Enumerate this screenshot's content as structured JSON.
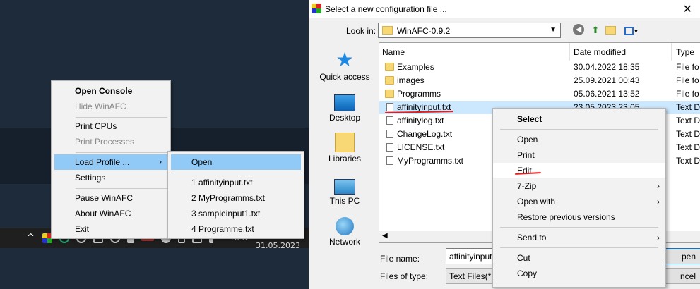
{
  "tray_menu": {
    "items": [
      {
        "label": "Open Console",
        "state": "bold"
      },
      {
        "label": "Hide WinAFC",
        "state": "disabled"
      },
      {
        "label": "Print CPUs",
        "state": "normal"
      },
      {
        "label": "Print Processes",
        "state": "disabled"
      },
      {
        "label": "Load Profile ...",
        "state": "highlighted"
      },
      {
        "label": "Settings",
        "state": "normal"
      },
      {
        "label": "Pause WinAFC",
        "state": "normal"
      },
      {
        "label": "About WinAFC",
        "state": "normal"
      },
      {
        "label": "Exit",
        "state": "normal"
      }
    ],
    "submenu_arrow": "›"
  },
  "profile_submenu": {
    "items": [
      "Open",
      "1 affinityinput.txt",
      "2 MyProgramms.txt",
      "3 sampleinput1.txt",
      "4 Programme.txt"
    ]
  },
  "taskbar": {
    "language": "DEU",
    "date": "31.05.2023",
    "chevron": "^"
  },
  "dialog": {
    "title": "Select a new configuration file ...",
    "close_glyph": "✕",
    "look_in_label": "Look in:",
    "look_in_value": "WinAFC-0.9.2",
    "places": [
      {
        "label": "Quick access",
        "icon": "star-icon"
      },
      {
        "label": "Desktop",
        "icon": "desktop-icon"
      },
      {
        "label": "Libraries",
        "icon": "libraries-icon"
      },
      {
        "label": "This PC",
        "icon": "computer-icon"
      },
      {
        "label": "Network",
        "icon": "network-icon"
      }
    ],
    "columns": {
      "name": "Name",
      "date": "Date modified",
      "type": "Type"
    },
    "files": [
      {
        "name": "Examples",
        "date": "30.04.2022 18:35",
        "type": "File fo",
        "kind": "folder"
      },
      {
        "name": "images",
        "date": "25.09.2021 00:43",
        "type": "File fo",
        "kind": "folder"
      },
      {
        "name": "Programms",
        "date": "05.06.2021 13:52",
        "type": "File fo",
        "kind": "folder"
      },
      {
        "name": "affinityinput.txt",
        "date": "23.05.2023 23:05",
        "type": "Text D",
        "kind": "file",
        "selected": true
      },
      {
        "name": "affinitylog.txt",
        "date": "",
        "type": "Text D",
        "kind": "file"
      },
      {
        "name": "ChangeLog.txt",
        "date": "",
        "type": "Text D",
        "kind": "file"
      },
      {
        "name": "LICENSE.txt",
        "date": "",
        "type": "Text D",
        "kind": "file"
      },
      {
        "name": "MyProgramms.txt",
        "date": "",
        "type": "Text D",
        "kind": "file"
      }
    ],
    "file_name_label": "File name:",
    "file_name_value": "affinityinput.txt",
    "file_type_label": "Files of type:",
    "file_type_value": "Text Files(*.txt",
    "open_button": "pen",
    "cancel_button": "ncel"
  },
  "context_menu": {
    "items": [
      "Select",
      "Open",
      "Print",
      "Edit",
      "7-Zip",
      "Open with",
      "Restore previous versions",
      "Send to",
      "Cut",
      "Copy"
    ]
  },
  "colors": {
    "highlight": "#91c9f7",
    "selection": "#cce8ff",
    "annotation": "#e02020"
  }
}
